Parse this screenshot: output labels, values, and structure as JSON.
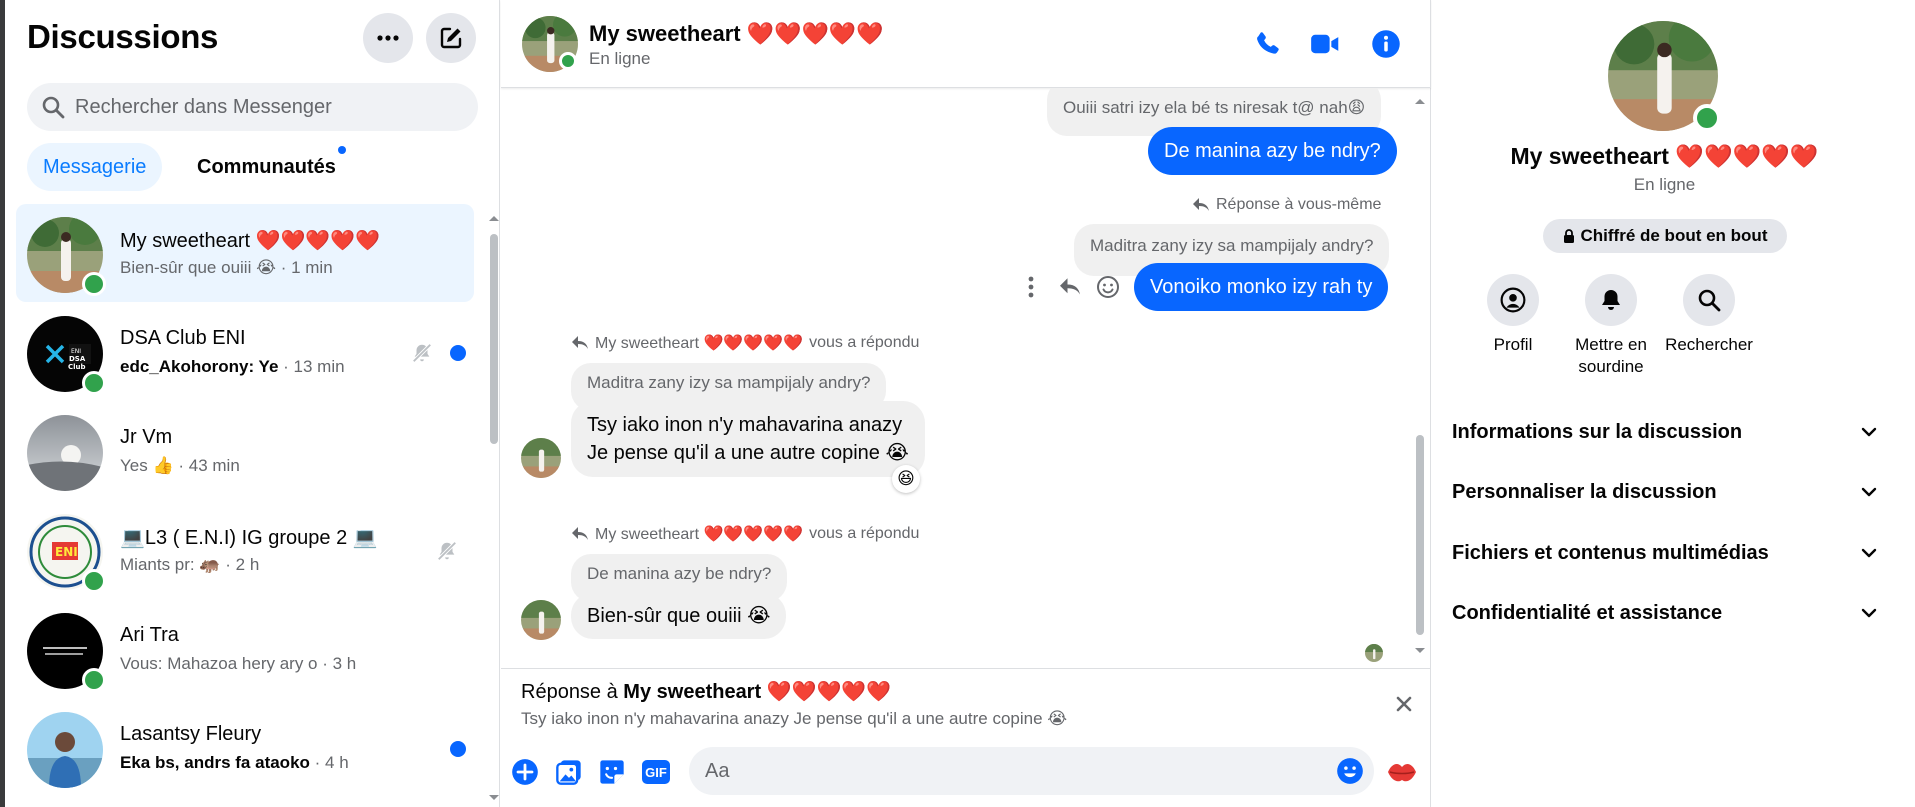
{
  "sidebar": {
    "title": "Discussions",
    "search_placeholder": "Rechercher dans Messenger",
    "tabs": {
      "messagerie": "Messagerie",
      "communautes": "Communautés"
    },
    "conversations": [
      {
        "name": "My sweetheart ❤️❤️❤️❤️❤️",
        "preview": "Bien-sûr que ouiii 😭",
        "time": "· 1 min"
      },
      {
        "name": "DSA Club ENI",
        "preview": "edc_Akohorony: Ye",
        "time": "· 13 min"
      },
      {
        "name": "Jr Vm",
        "preview": "Yes 👍",
        "time": "· 43 min"
      },
      {
        "name": "💻L3 ( E.N.I) IG groupe 2 💻",
        "preview": "Miants pr: 🦛",
        "time": "· 2 h"
      },
      {
        "name": "Ari Tra",
        "preview": "Vous: Mahazoa hery ary o",
        "time": "· 3 h"
      },
      {
        "name": "Lasantsy Fleury",
        "preview": "Eka bs, andrs fa ataoko",
        "time": "· 4 h"
      }
    ]
  },
  "chat": {
    "name": "My sweetheart ❤️❤️❤️❤️❤️",
    "status": "En ligne",
    "messages": {
      "m1_quoted": "Ouiii satri izy ela bé ts niresak t@ nah😩",
      "m1_text": "De manina azy be ndry?",
      "m2_meta": "Réponse à vous-même",
      "m2_quoted": "Maditra zany izy sa mampijaly andry?",
      "m2_text": "Vonoiko monko izy rah ty",
      "m3_meta_name": "My sweetheart ❤️❤️❤️❤️❤️",
      "m3_meta_suffix": "vous a répondu",
      "m3_quoted": "Maditra zany izy sa mampijaly andry?",
      "m3_line1": "Tsy iako inon n'y mahavarina anazy",
      "m3_line2": "Je pense qu'il a une autre copine 😭",
      "m3_reaction": "😆",
      "m4_meta_name": "My sweetheart ❤️❤️❤️❤️❤️",
      "m4_meta_suffix": "vous a répondu",
      "m4_quoted": "De manina azy be ndry?",
      "m4_text": "Bien-sûr que ouiii 😭"
    },
    "reply_bar": {
      "prefix": "Réponse à ",
      "name": "My sweetheart ❤️❤️❤️❤️❤️",
      "text": "Tsy iako inon n'y mahavarina anazy Je pense qu'il a une autre copine 😭"
    },
    "composer": {
      "placeholder": "Aa",
      "gif_label": "GIF"
    }
  },
  "info_panel": {
    "name": "My sweetheart ❤️❤️❤️❤️❤️",
    "status": "En ligne",
    "e2e": "Chiffré de bout en bout",
    "actions": {
      "profil": "Profil",
      "mute": "Mettre en sourdine",
      "search": "Rechercher"
    },
    "sections": {
      "info": "Informations sur la discussion",
      "customize": "Personnaliser la discussion",
      "files": "Fichiers et contenus multimédias",
      "privacy": "Confidentialité et assistance"
    }
  },
  "colors": {
    "accent": "#0866ff",
    "online": "#31a24c",
    "tab_active_bg": "#ebf5ff",
    "bubble_in": "#f0f0f0"
  }
}
